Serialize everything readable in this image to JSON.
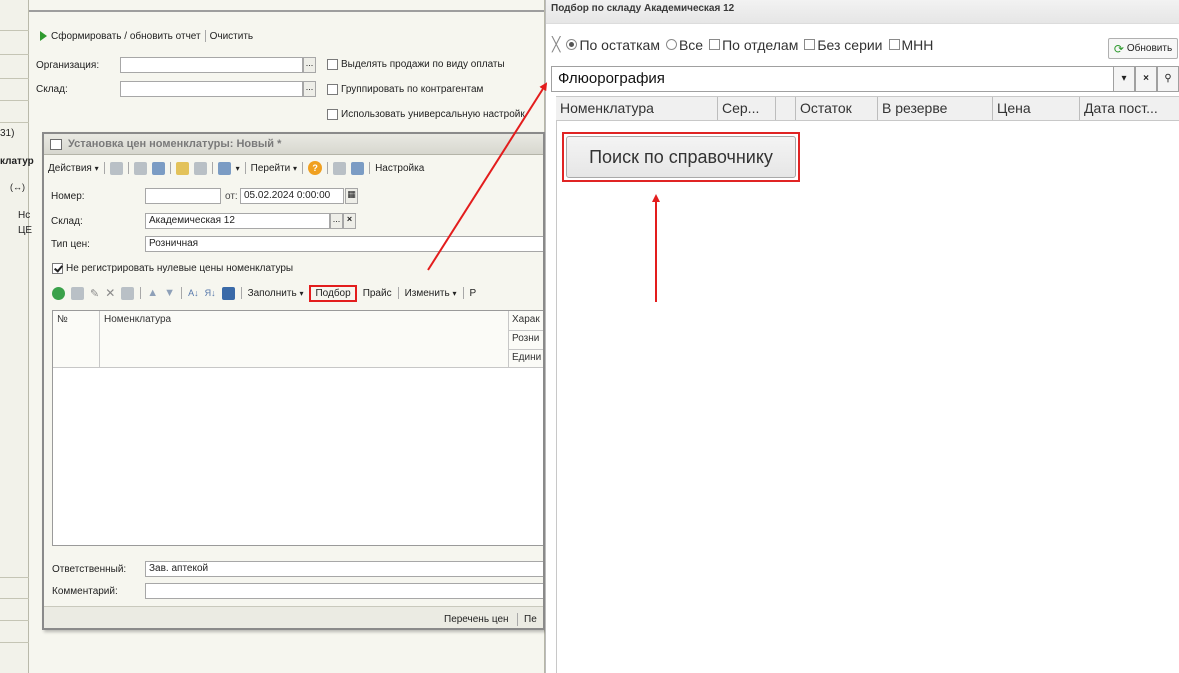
{
  "report_window": {
    "side_label_1": "31)",
    "side_label_2": "клатур",
    "side_label_3": "(↔)",
    "side_label_4": "Нс",
    "side_label_5": "ЦЕ",
    "generate_label": "Сформировать / обновить отчет",
    "clear_label": "Очистить",
    "org_label": "Организация:",
    "warehouse_label": "Склад:",
    "chk_sales_by_payment": "Выделять продажи по виду оплаты",
    "chk_group_by_contractors": "Группировать по контрагентам",
    "chk_universal_settings": "Использовать универсальную настройк",
    "dots": "..."
  },
  "dialog": {
    "title": "Установка цен номенклатуры: Новый *",
    "toolbar": {
      "actions": "Действия",
      "goto": "Перейти",
      "settings": "Настройка"
    },
    "number_label": "Номер:",
    "number_value": "",
    "date_prefix": "от:",
    "date_value": "05.02.2024 0:00:00",
    "warehouse_label": "Склад:",
    "warehouse_value": "Академическая 12",
    "price_type_label": "Тип цен:",
    "price_type_value": "Розничная",
    "no_register_zero_label": "Не регистрировать нулевые цены номенклатуры",
    "no_register_zero_checked": true,
    "table_toolbar": {
      "fill": "Заполнить",
      "pick": "Подбор",
      "price": "Прайс",
      "change": "Изменить",
      "more": "Р"
    },
    "table_headers": {
      "num": "№",
      "nomenclature": "Номенклатура",
      "char": "Харак",
      "retail": "Розни",
      "unit": "Едини"
    },
    "responsible_label": "Ответственный:",
    "responsible_value": "Зав. аптекой",
    "comment_label": "Комментарий:",
    "comment_value": "",
    "footer_link_1": "Перечень цен",
    "footer_link_2": "Пе"
  },
  "pick_window": {
    "title": "Подбор по складу Академическая 12",
    "filters": {
      "by_stock": "По остаткам",
      "all": "Все",
      "by_departments": "По отделам",
      "no_series": "Без серии",
      "inn": "МНН"
    },
    "refresh": "Обновить",
    "search_value": "Флюорография",
    "columns": [
      "Номенклатура",
      "Сер...",
      "Остаток",
      "В резерве",
      "Цена",
      "Дата пост..."
    ],
    "search_directory_button": "Поиск по справочнику"
  },
  "colors": {
    "accent_red": "#e31d1d",
    "play_green": "#2e9a2e"
  }
}
